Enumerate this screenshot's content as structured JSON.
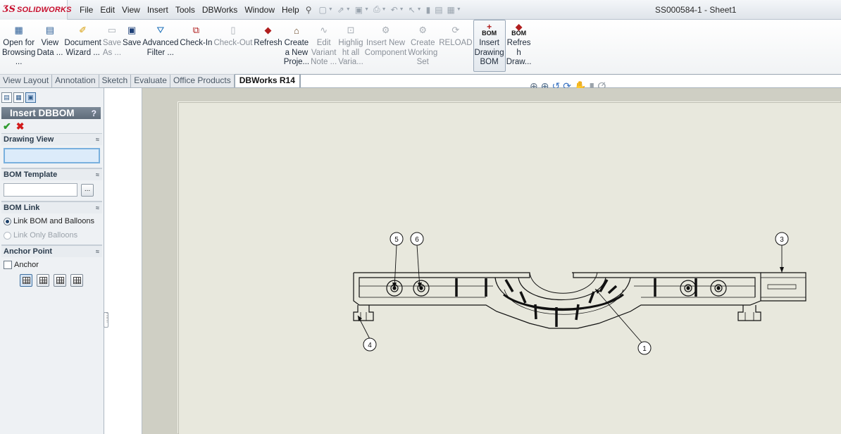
{
  "app": {
    "logo_mark": "ƷS",
    "logo_text": "SOLIDWORKS",
    "document_title": "SS000584-1 - Sheet1"
  },
  "menu": [
    "File",
    "Edit",
    "View",
    "Insert",
    "Tools",
    "DBWorks",
    "Window",
    "Help"
  ],
  "ribbon": {
    "buttons": [
      {
        "label": "Open for\nBrowsing\n...",
        "icon": "open-browse-icon",
        "color": "#2b5d96",
        "glyph": "▦",
        "enabled": true
      },
      {
        "label": "View\nData ...",
        "icon": "view-data-icon",
        "color": "#2b5d96",
        "glyph": "▤",
        "enabled": true
      },
      {
        "label": "Document\nWizard ...",
        "icon": "document-wizard-icon",
        "color": "#d69a00",
        "glyph": "✐",
        "enabled": true
      },
      {
        "label": "Save\nAs ...",
        "icon": "save-as-icon",
        "color": "#7a8590",
        "glyph": "▭",
        "enabled": false
      },
      {
        "label": "Save",
        "icon": "save-icon",
        "color": "#1c3f77",
        "glyph": "▣",
        "enabled": true
      },
      {
        "label": "Advanced\nFilter ...",
        "icon": "advanced-filter-icon",
        "color": "#1a6fb8",
        "glyph": "⛛",
        "enabled": true
      },
      {
        "label": "Check-In",
        "icon": "check-in-icon",
        "color": "#b01e1e",
        "glyph": "⧉",
        "enabled": true
      },
      {
        "label": "Check-Out",
        "icon": "check-out-icon",
        "color": "#7a8590",
        "glyph": "▯",
        "enabled": false
      },
      {
        "label": "Refresh",
        "icon": "refresh-icon",
        "color": "#b01e1e",
        "glyph": "◆",
        "enabled": true
      },
      {
        "label": "Create\na New\nProje...",
        "icon": "create-project-icon",
        "color": "#6b4a2b",
        "glyph": "⌂",
        "enabled": true
      },
      {
        "label": "Edit\nVariant\nNote ...",
        "icon": "edit-variant-icon",
        "color": "#7a8590",
        "glyph": "∿",
        "enabled": false
      },
      {
        "label": "Highlig\nht all\nVaria...",
        "icon": "highlight-variants-icon",
        "color": "#7a8590",
        "glyph": "⊡",
        "enabled": false
      },
      {
        "label": "Insert New\nComponent",
        "icon": "insert-component-icon",
        "color": "#7a8590",
        "glyph": "⚙",
        "enabled": false
      },
      {
        "label": "Create\nWorking\nSet",
        "icon": "working-set-icon",
        "color": "#7a8590",
        "glyph": "⚙",
        "enabled": false
      },
      {
        "label": "RELOAD",
        "icon": "reload-icon",
        "color": "#7a8590",
        "glyph": "⟳",
        "enabled": false
      },
      {
        "label": "Insert\nDrawing\nBOM",
        "icon": "insert-bom-icon",
        "color": "#b01e1e",
        "glyph": "+",
        "bom": "BOM",
        "enabled": true,
        "active": true
      },
      {
        "label": "Refres\nh\nDraw...",
        "icon": "refresh-bom-icon",
        "color": "#b01e1e",
        "glyph": "◆",
        "bom": "BOM",
        "enabled": true
      }
    ]
  },
  "tabs": [
    {
      "label": "View Layout",
      "active": false
    },
    {
      "label": "Annotation",
      "active": false
    },
    {
      "label": "Sketch",
      "active": false
    },
    {
      "label": "Evaluate",
      "active": false
    },
    {
      "label": "Office Products",
      "active": false
    },
    {
      "label": "DBWorks R14",
      "active": true
    }
  ],
  "property_manager": {
    "title": "Insert DBBOM",
    "help": "?",
    "ok_glyph": "✔",
    "cancel_glyph": "✖",
    "groups": {
      "drawing_view": {
        "title": "Drawing View",
        "value": ""
      },
      "bom_template": {
        "title": "BOM Template",
        "value": "",
        "browse_label": "..."
      },
      "bom_link": {
        "title": "BOM Link",
        "options": [
          {
            "label": "Link BOM and Balloons",
            "selected": true,
            "enabled": true
          },
          {
            "label": "Link Only Balloons",
            "selected": false,
            "enabled": false
          }
        ]
      },
      "anchor_point": {
        "title": "Anchor Point",
        "checkbox_label": "Anchor",
        "checked": false
      }
    },
    "collapse_glyph": "≈"
  },
  "drawing": {
    "balloons": [
      "1",
      "3",
      "4",
      "5",
      "6"
    ]
  }
}
